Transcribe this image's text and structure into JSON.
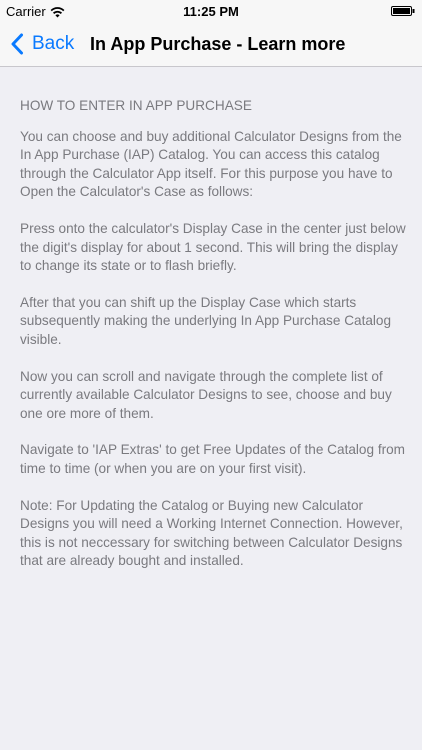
{
  "status_bar": {
    "carrier": "Carrier",
    "time": "11:25 PM"
  },
  "nav": {
    "back_label": "Back",
    "title": "In App Purchase - Learn more",
    "accent_color": "#0a7aff"
  },
  "content": {
    "heading": "HOW TO ENTER IN APP PURCHASE",
    "paragraphs": [
      "You can choose and buy additional Calculator Designs from the In App Purchase (IAP) Catalog. You can access this catalog through the Calculator App itself. For this purpose you have to Open the Calculator's Case as follows:",
      "Press onto the calculator's Display Case in the center just below the digit's display for about 1 second. This will bring the display to change its state or to flash briefly.",
      "After that you can shift up the Display Case which starts subsequently making the underlying In App Purchase Catalog visible.",
      "Now you can scroll and navigate through the complete list of currently available Calculator Designs to see, choose and buy one ore more of them.",
      "Navigate to 'IAP Extras' to get Free Updates of the Catalog from time to time (or when you are on your first visit).",
      "Note: For Updating the Catalog or Buying new Calculator Designs you will need a Working Internet Connection. However, this is not neccessary for switching between Calculator Designs that are already bought and installed."
    ]
  },
  "icons": {
    "wifi": "wifi-icon",
    "battery": "battery-icon",
    "back": "chevron-left-icon"
  }
}
